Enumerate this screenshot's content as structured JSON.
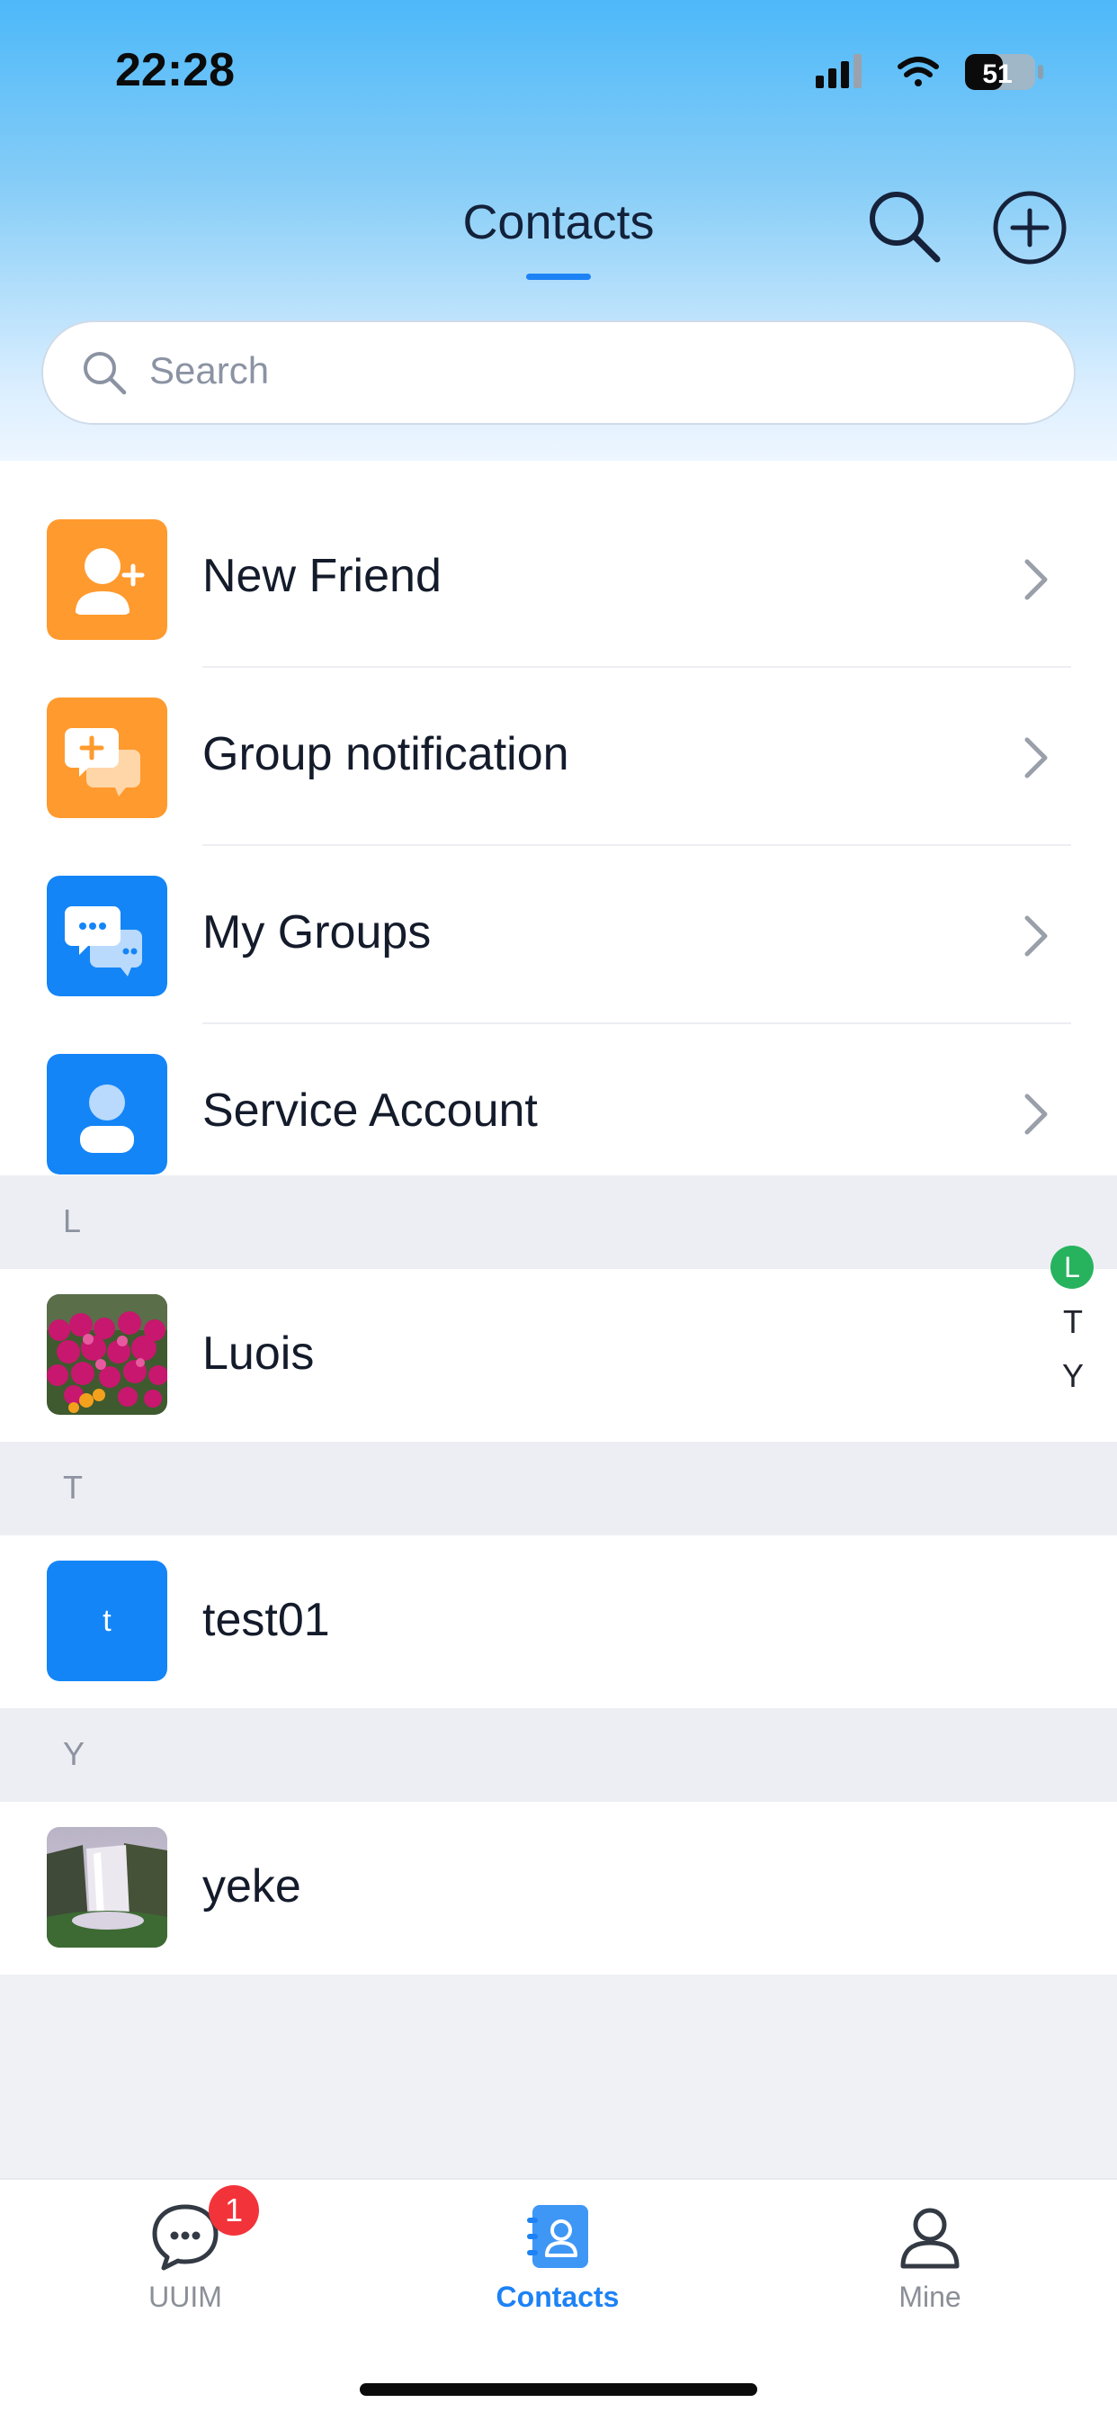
{
  "status_bar": {
    "time": "22:28",
    "battery": "51"
  },
  "header": {
    "title": "Contacts",
    "search_icon": "search-icon",
    "add_icon": "plus-circle-icon"
  },
  "search": {
    "placeholder": "Search"
  },
  "menu": [
    {
      "label": "New Friend",
      "icon": "add-person-icon",
      "color": "#ff9a2e"
    },
    {
      "label": "Group notification",
      "icon": "chat-plus-icon",
      "color": "#ff9a2e"
    },
    {
      "label": "My Groups",
      "icon": "group-chat-icon",
      "color": "#1485f7"
    },
    {
      "label": "Service Account",
      "icon": "person-icon",
      "color": "#1485f7"
    }
  ],
  "sections": [
    {
      "letter": "L",
      "contacts": [
        {
          "name": "Luois",
          "avatar": "flowers-photo"
        }
      ]
    },
    {
      "letter": "T",
      "contacts": [
        {
          "name": "test01",
          "avatar_letter": "t",
          "avatar_color": "#1485f7"
        }
      ]
    },
    {
      "letter": "Y",
      "contacts": [
        {
          "name": "yeke",
          "avatar": "waterfall-photo"
        }
      ]
    }
  ],
  "index_bar": [
    "L",
    "T",
    "Y"
  ],
  "tabs": [
    {
      "label": "UUIM",
      "icon": "chat-icon",
      "badge": "1",
      "active": false
    },
    {
      "label": "Contacts",
      "icon": "contacts-icon",
      "active": true
    },
    {
      "label": "Mine",
      "icon": "user-icon",
      "active": false
    }
  ],
  "colors": {
    "accent": "#1d82f5",
    "orange": "#ff9a2e",
    "index_active": "#27b35e",
    "badge": "#f3333a"
  }
}
